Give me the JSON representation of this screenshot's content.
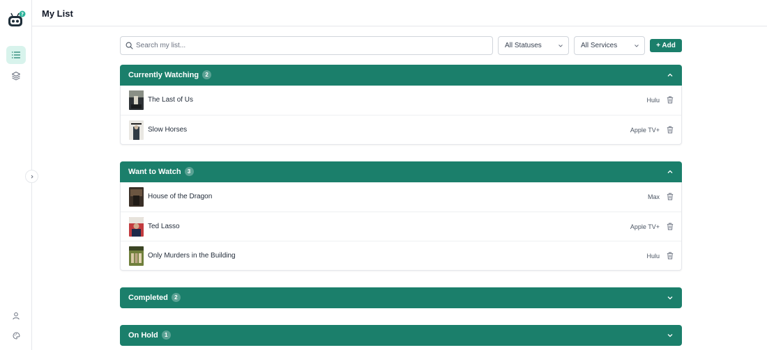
{
  "page": {
    "title": "My List"
  },
  "toolbar": {
    "search_placeholder": "Search my list...",
    "status_filter": "All Statuses",
    "service_filter": "All Services",
    "add_label": "+ Add"
  },
  "sidebar": {
    "items": [
      {
        "icon": "list-icon",
        "active": true
      },
      {
        "icon": "layers-icon",
        "active": false
      },
      {
        "icon": "user-icon",
        "active": false
      },
      {
        "icon": "palette-icon",
        "active": false
      }
    ],
    "collapse_icon": "chevron-right-icon"
  },
  "sections": [
    {
      "title": "Currently Watching",
      "count": "2",
      "expanded": true,
      "items": [
        {
          "title": "The Last of Us",
          "service": "Hulu",
          "poster_color": "#3b3f44"
        },
        {
          "title": "Slow Horses",
          "service": "Apple TV+",
          "poster_color": "#5b5f5a"
        }
      ]
    },
    {
      "title": "Want to Watch",
      "count": "3",
      "expanded": true,
      "items": [
        {
          "title": "House of the Dragon",
          "service": "Max",
          "poster_color": "#4a3a2c"
        },
        {
          "title": "Ted Lasso",
          "service": "Apple TV+",
          "poster_color": "#8a3a4a"
        },
        {
          "title": "Only Murders in the Building",
          "service": "Hulu",
          "poster_color": "#6b7a3a"
        }
      ]
    },
    {
      "title": "Completed",
      "count": "2",
      "expanded": false,
      "items": []
    },
    {
      "title": "On Hold",
      "count": "1",
      "expanded": false,
      "items": []
    }
  ],
  "colors": {
    "accent": "#1b7f6b",
    "active_nav_bg": "#d8f3ec"
  }
}
